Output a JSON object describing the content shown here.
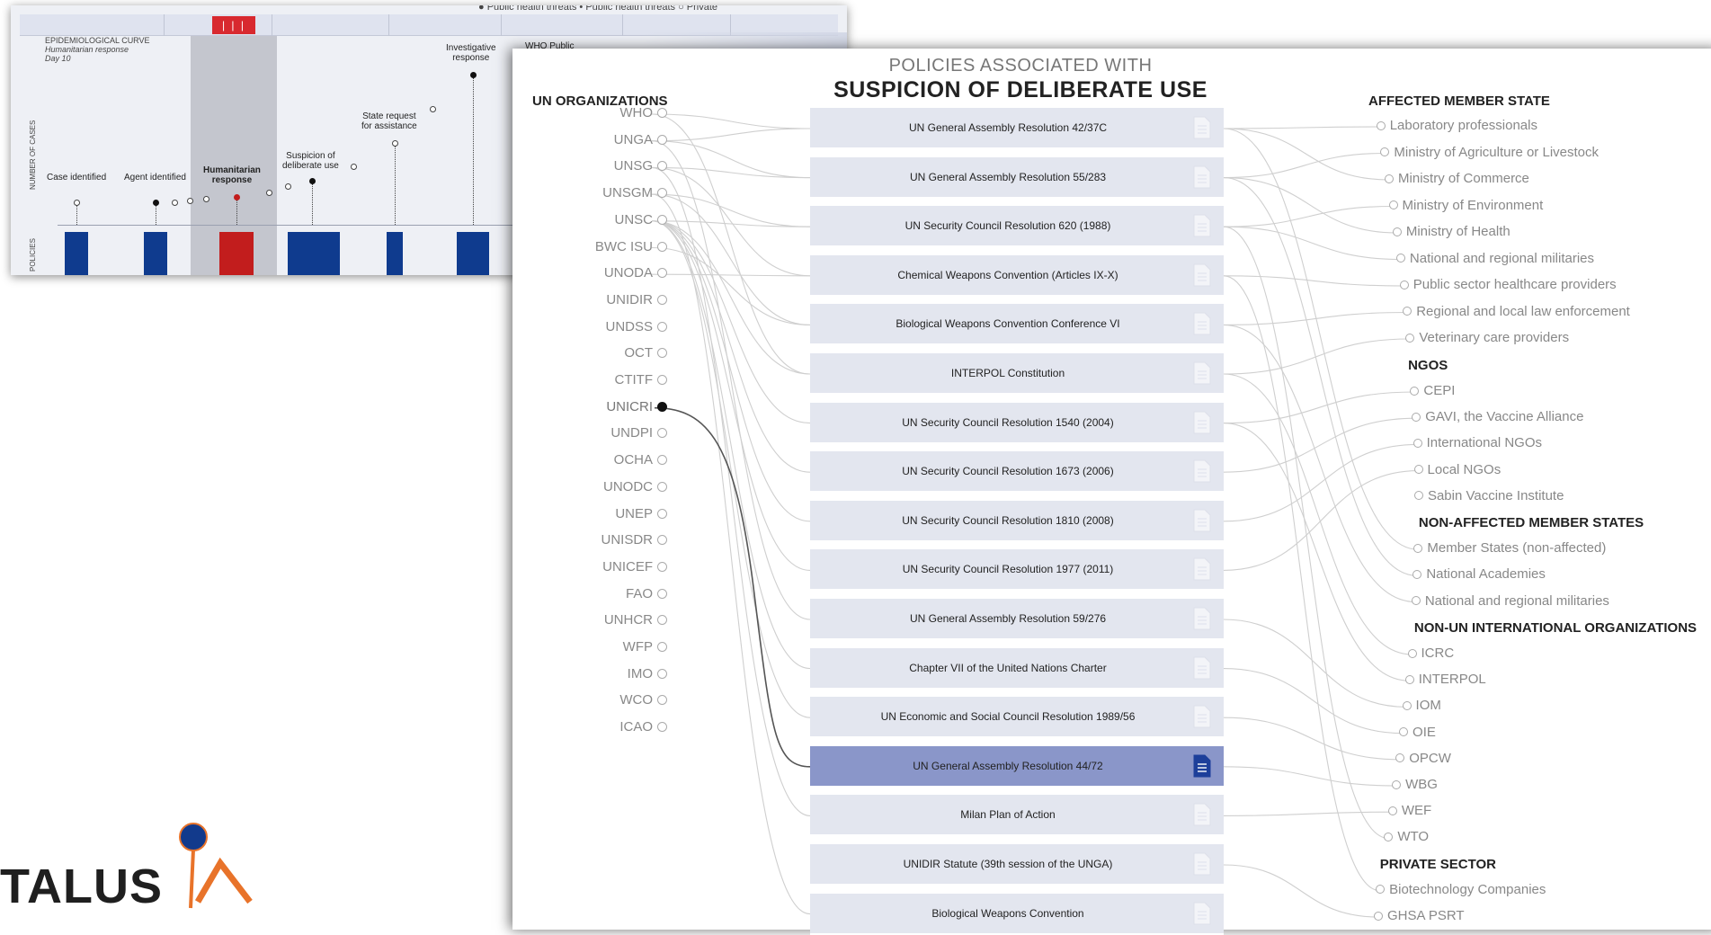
{
  "epi_panel": {
    "legend": "● Public health threats • Public health threats ○ Private",
    "timeline_badge": "| | |",
    "curve_title": "EPIDEMIOLOGICAL CURVE",
    "curve_sub1": "Humanitarian response",
    "curve_sub2": "Day 10",
    "axis_cases": "NUMBER OF CASES",
    "axis_policies": "POLICIES",
    "events": [
      {
        "l1": "Case identified",
        "l2": ""
      },
      {
        "l1": "Agent identified",
        "l2": ""
      },
      {
        "l1": "Humanitarian",
        "l2": "response"
      },
      {
        "l1": "Suspicion of",
        "l2": "deliberate use"
      },
      {
        "l1": "State request",
        "l2": "for assistance"
      },
      {
        "l1": "Investigative",
        "l2": "response"
      },
      {
        "l1": "WHO Public",
        "l2": ""
      }
    ]
  },
  "main": {
    "header_small": "POLICIES ASSOCIATED WITH",
    "header_big": "SUSPICION OF DELIBERATE USE",
    "un_heading": "UN ORGANIZATIONS",
    "affected_heading": "AFFECTED MEMBER STATE",
    "un_orgs": [
      "WHO",
      "UNGA",
      "UNSG",
      "UNSGM",
      "UNSC",
      "BWC ISU",
      "UNODA",
      "UNIDIR",
      "UNDSS",
      "OCT",
      "CTITF",
      "UNICRI",
      "UNDPI",
      "OCHA",
      "UNODC",
      "UNEP",
      "UNISDR",
      "UNICEF",
      "FAO",
      "UNHCR",
      "WFP",
      "IMO",
      "WCO",
      "ICAO"
    ],
    "active_org": "UNICRI",
    "policies": [
      "UN General Assembly Resolution 42/37C",
      "UN General Assembly Resolution 55/283",
      "UN Security Council Resolution 620 (1988)",
      "Chemical Weapons Convention (Articles IX-X)",
      "Biological Weapons Convention Conference VI",
      "INTERPOL Constitution",
      "UN Security Council Resolution 1540 (2004)",
      "UN Security Council Resolution 1673 (2006)",
      "UN Security Council Resolution 1810 (2008)",
      "UN Security Council Resolution 1977 (2011)",
      "UN General Assembly Resolution 59/276",
      "Chapter VII of the United Nations Charter",
      "UN Economic and Social Council Resolution 1989/56",
      "UN General Assembly Resolution 44/72",
      "Milan Plan of Action",
      "UNIDIR Statute (39th session of the UNGA)",
      "Biological Weapons Convention"
    ],
    "active_policy": "UN General Assembly Resolution 44/72",
    "affected": [
      "Laboratory professionals",
      "Ministry of Agriculture or Livestock",
      "Ministry of Commerce",
      "Ministry of Environment",
      "Ministry of Health",
      "National and regional militaries",
      "Public sector healthcare providers",
      "Regional and local law enforcement",
      "Veterinary care providers"
    ],
    "ngos_heading": "NGOS",
    "ngos": [
      "CEPI",
      "GAVI, the Vaccine Alliance",
      "International NGOs",
      "Local NGOs",
      "Sabin Vaccine Institute"
    ],
    "non_affected_heading": "NON-AFFECTED MEMBER STATES",
    "non_affected": [
      "Member States (non-affected)",
      "National Academies",
      "National and regional militaries"
    ],
    "non_un_heading": "NON-UN INTERNATIONAL ORGANIZATIONS",
    "non_un": [
      "ICRC",
      "INTERPOL",
      "IOM",
      "OIE",
      "OPCW",
      "WBG",
      "WEF",
      "WTO"
    ],
    "private_heading": "PRIVATE SECTOR",
    "private": [
      "Biotechnology Companies",
      "GHSA PSRT"
    ]
  },
  "logo": {
    "text": "TALUS",
    "colors": {
      "dot": "#123a8c",
      "check": "#e8732a"
    }
  },
  "colors": {
    "blue_bar": "#0f3b8e",
    "red_bar": "#c21d1d",
    "policy_bg": "#e3e6ef",
    "policy_active": "#8a96c9"
  }
}
